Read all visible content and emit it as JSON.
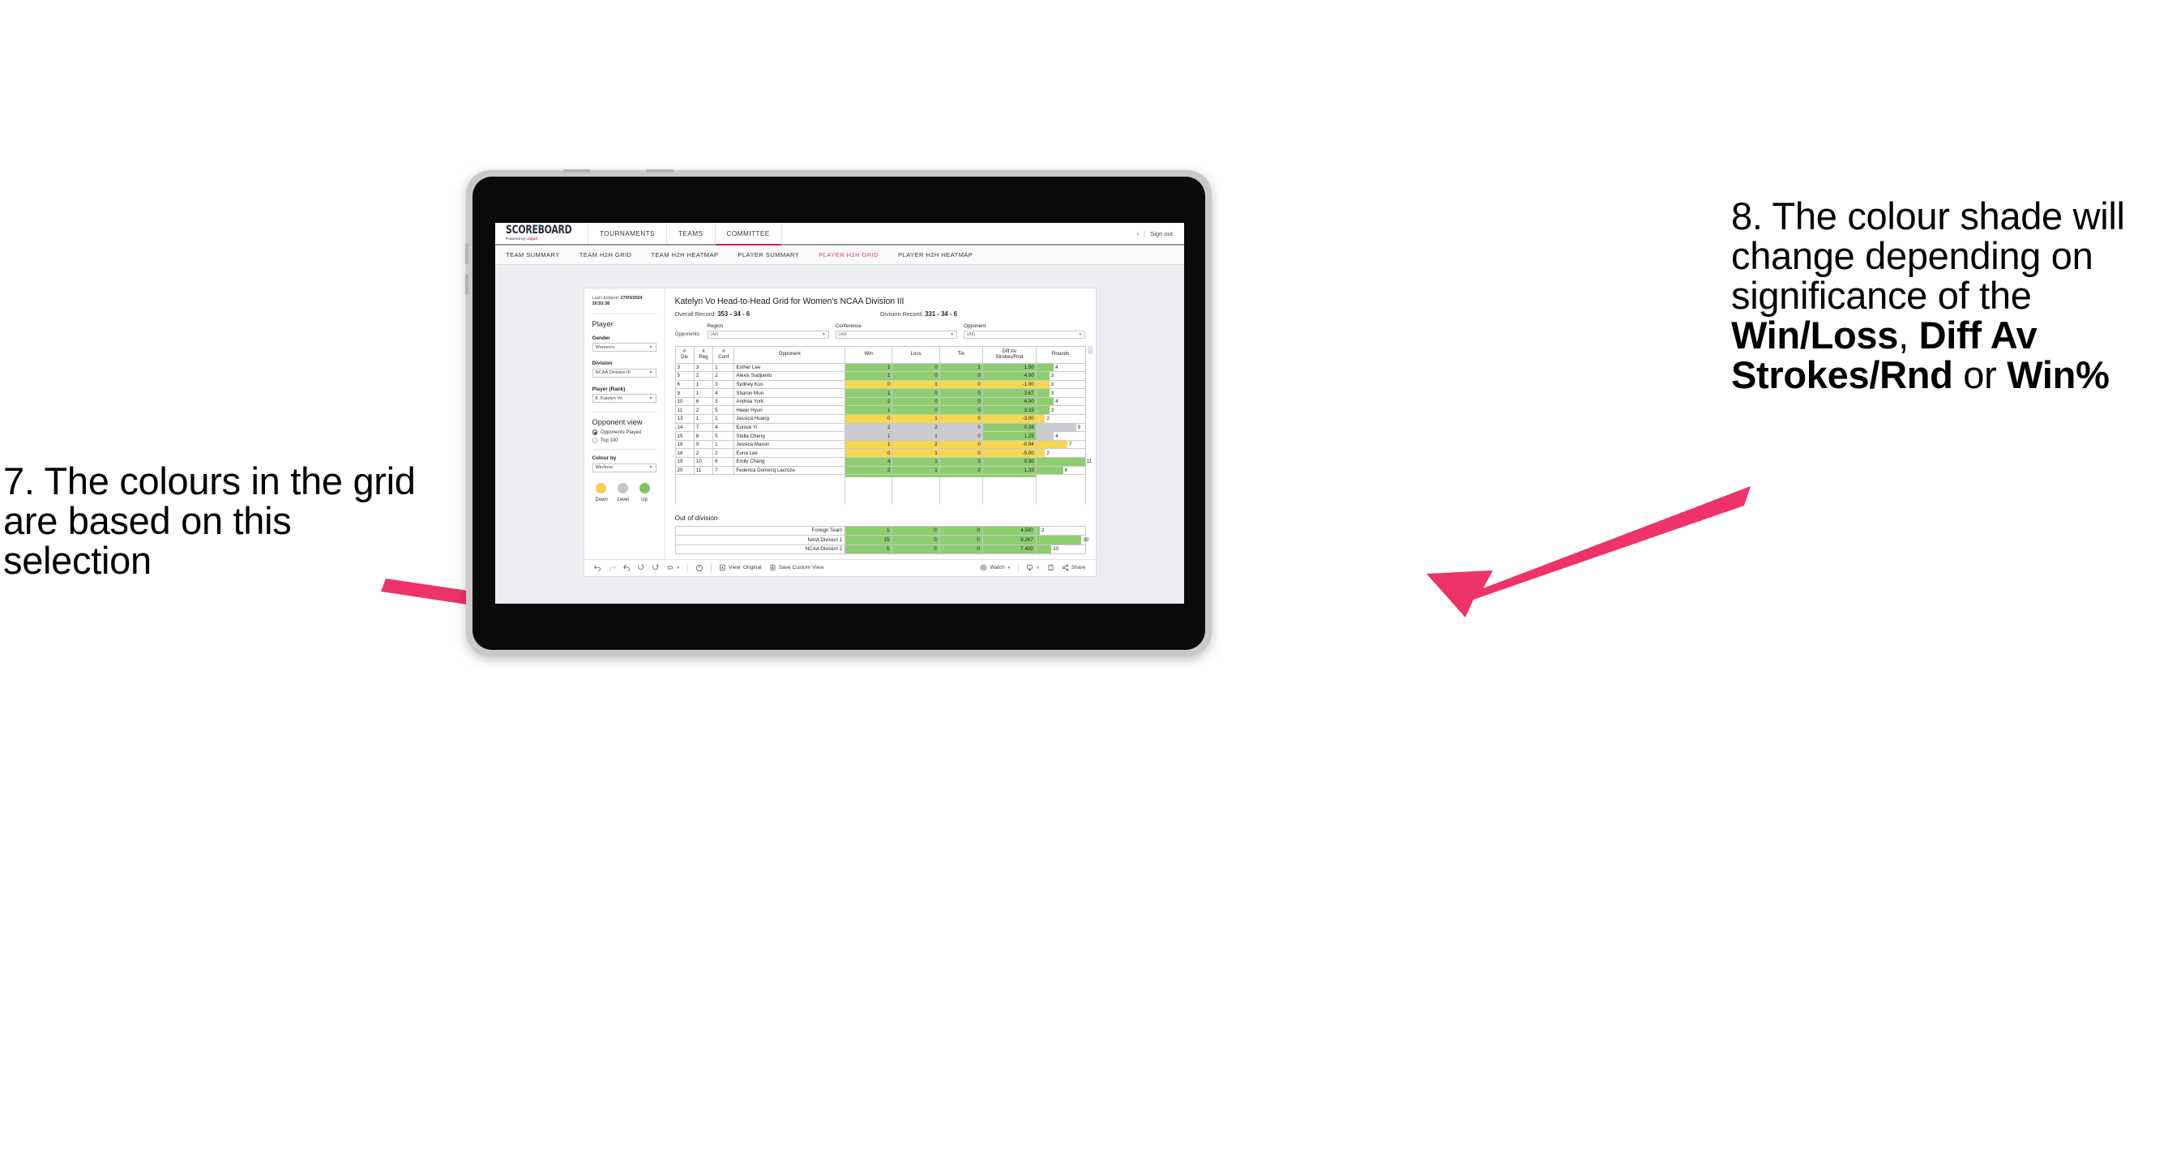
{
  "annotations": {
    "left": {
      "id": "7",
      "text": "7. The colours in the grid are based on this selection"
    },
    "right": {
      "id": "8",
      "line1": "8. The colour shade will change depending on significance of the ",
      "bold1": "Win/Loss",
      "mid1": ", ",
      "bold2": "Diff Av Strokes/Rnd",
      "mid2": " or ",
      "bold3": "Win%"
    },
    "arrow_color": "#ee3366"
  },
  "app": {
    "logo": {
      "main": "SCOREBOARD",
      "sub_prefix": "Powered by ",
      "sub_brand": "clippd"
    },
    "top_tabs": [
      {
        "label": "TOURNAMENTS",
        "active": false
      },
      {
        "label": "TEAMS",
        "active": false
      },
      {
        "label": "COMMITTEE",
        "active": true
      }
    ],
    "header_right": {
      "chevron": "›",
      "divider": "|",
      "sign_out": "Sign out"
    },
    "sub_tabs": [
      {
        "label": "TEAM SUMMARY",
        "active": false
      },
      {
        "label": "TEAM H2H GRID",
        "active": false
      },
      {
        "label": "TEAM H2H HEATMAP",
        "active": false
      },
      {
        "label": "PLAYER SUMMARY",
        "active": false
      },
      {
        "label": "PLAYER H2H GRID",
        "active": true
      },
      {
        "label": "PLAYER H2H HEATMAP",
        "active": false
      }
    ]
  },
  "sidebar": {
    "last_updated_label": "Last Updated: ",
    "last_updated_value": "27/03/2024 16:55:38",
    "player_heading": "Player",
    "fields": [
      {
        "label": "Gender",
        "value": "Women’s"
      },
      {
        "label": "Division",
        "value": "NCAA Division III"
      },
      {
        "label": "Player (Rank)",
        "value": "8. Katelyn Vo"
      }
    ],
    "opponent_view": {
      "heading": "Opponent view",
      "options": [
        {
          "label": "Opponents Played",
          "selected": true
        },
        {
          "label": "Top 100",
          "selected": false
        }
      ]
    },
    "colour_by": {
      "label": "Colour by",
      "value": "Win/loss"
    },
    "legend": [
      {
        "label": "Down",
        "color": "#f3d04e"
      },
      {
        "label": "Level",
        "color": "#c4c6ca"
      },
      {
        "label": "Up",
        "color": "#7fc35c"
      }
    ]
  },
  "panel": {
    "title": "Katelyn Vo Head-to-Head Grid for Women’s NCAA Division III",
    "overall_record_label": "Overall Record: ",
    "overall_record_value": "353 - 34 - 6",
    "division_record_label": "Division Record: ",
    "division_record_value": "331 - 34 - 6",
    "opponents_label": "Opponents:",
    "opponent_filters": [
      {
        "label": "Region",
        "value": "(All)"
      },
      {
        "label": "Conference",
        "value": "(All)"
      },
      {
        "label": "Opponent",
        "value": "(All)"
      }
    ]
  },
  "grid": {
    "headers": [
      "#\nDiv",
      "#\nReg",
      "#\nConf",
      "Opponent",
      "Win",
      "Loss",
      "Tie",
      "Diff Av\nStrokes/Rnd",
      "Rounds"
    ],
    "header_lines": [
      [
        "#",
        "Div"
      ],
      [
        "#",
        "Reg"
      ],
      [
        "#",
        "Conf"
      ],
      [
        "Opponent"
      ],
      [
        "Win"
      ],
      [
        "Loss"
      ],
      [
        "Tie"
      ],
      [
        "Diff Av",
        "Strokes/Rnd"
      ],
      [
        "Rounds"
      ]
    ],
    "rows": [
      {
        "div": "3",
        "reg": "3",
        "conf": "1",
        "opponent": "Esther Lee",
        "win": "1",
        "loss": "0",
        "tie": "1",
        "diff": "1.50",
        "rounds": "4",
        "color": "green",
        "bar_pct": 36
      },
      {
        "div": "5",
        "reg": "2",
        "conf": "2",
        "opponent": "Alexis Sudjianto",
        "win": "1",
        "loss": "0",
        "tie": "0",
        "diff": "4.00",
        "rounds": "3",
        "color": "green",
        "bar_pct": 27
      },
      {
        "div": "6",
        "reg": "1",
        "conf": "3",
        "opponent": "Sydney Kuo",
        "win": "0",
        "loss": "1",
        "tie": "0",
        "diff": "-1.00",
        "rounds": "3",
        "color": "yellow",
        "bar_pct": 27
      },
      {
        "div": "9",
        "reg": "1",
        "conf": "4",
        "opponent": "Sharon Mun",
        "win": "1",
        "loss": "0",
        "tie": "0",
        "diff": "3.67",
        "rounds": "3",
        "color": "green",
        "bar_pct": 27
      },
      {
        "div": "10",
        "reg": "6",
        "conf": "3",
        "opponent": "Andrea York",
        "win": "2",
        "loss": "0",
        "tie": "0",
        "diff": "4.00",
        "rounds": "4",
        "color": "green",
        "bar_pct": 36
      },
      {
        "div": "11",
        "reg": "2",
        "conf": "5",
        "opponent": "Heejo Hyun",
        "win": "1",
        "loss": "0",
        "tie": "0",
        "diff": "3.33",
        "rounds": "3",
        "color": "green",
        "bar_pct": 27
      },
      {
        "div": "13",
        "reg": "1",
        "conf": "1",
        "opponent": "Jessica Huang",
        "win": "0",
        "loss": "1",
        "tie": "0",
        "diff": "-3.00",
        "rounds": "2",
        "color": "yellow",
        "bar_pct": 18
      },
      {
        "div": "14",
        "reg": "7",
        "conf": "4",
        "opponent": "Eunice Yi",
        "win": "2",
        "loss": "2",
        "tie": "0",
        "diff": "0.38",
        "rounds": "9",
        "color": "grey",
        "diff_color": "green",
        "bar_pct": 82
      },
      {
        "div": "15",
        "reg": "8",
        "conf": "5",
        "opponent": "Stella Cheng",
        "win": "1",
        "loss": "1",
        "tie": "0",
        "diff": "1.25",
        "rounds": "4",
        "color": "grey",
        "diff_color": "green",
        "bar_pct": 36
      },
      {
        "div": "16",
        "reg": "9",
        "conf": "1",
        "opponent": "Jessica Mason",
        "win": "1",
        "loss": "2",
        "tie": "0",
        "diff": "-0.94",
        "rounds": "7",
        "color": "yellow",
        "bar_pct": 64
      },
      {
        "div": "18",
        "reg": "2",
        "conf": "2",
        "opponent": "Euna Lee",
        "win": "0",
        "loss": "1",
        "tie": "0",
        "diff": "-5.00",
        "rounds": "2",
        "color": "yellow",
        "bar_pct": 18
      },
      {
        "div": "19",
        "reg": "10",
        "conf": "6",
        "opponent": "Emily Chang",
        "win": "4",
        "loss": "1",
        "tie": "0",
        "diff": "0.30",
        "rounds": "11",
        "color": "green",
        "bar_pct": 100
      },
      {
        "div": "20",
        "reg": "11",
        "conf": "7",
        "opponent": "Federica Domecq Lacroze",
        "win": "2",
        "loss": "1",
        "tie": "0",
        "diff": "1.33",
        "rounds": "6",
        "color": "green",
        "bar_pct": 55
      }
    ]
  },
  "out_of_division": {
    "title": "Out of division",
    "rows": [
      {
        "name": "Foreign Team",
        "win": "1",
        "loss": "0",
        "tie": "0",
        "diff": "4.500",
        "rounds": "2",
        "color": "green",
        "bar_pct": 7
      },
      {
        "name": "NAIA Division 1",
        "win": "15",
        "loss": "0",
        "tie": "0",
        "diff": "9.267",
        "rounds": "30",
        "color": "green",
        "bar_pct": 93
      },
      {
        "name": "NCAA Division 2",
        "win": "5",
        "loss": "0",
        "tie": "0",
        "diff": "7.400",
        "rounds": "10",
        "color": "green",
        "bar_pct": 31
      }
    ]
  },
  "toolbar": {
    "items": [
      {
        "name": "undo-icon",
        "label": ""
      },
      {
        "name": "redo-icon",
        "label": ""
      },
      {
        "name": "revert-icon",
        "label": ""
      },
      {
        "name": "refresh-icon",
        "label": ""
      },
      {
        "name": "pause-icon",
        "label": ""
      },
      {
        "name": "rectangle-select-icon",
        "label": ""
      }
    ],
    "view_label": "View: Original",
    "save_label": "Save Custom View",
    "watch_label": "Watch",
    "share_label": "Share"
  }
}
